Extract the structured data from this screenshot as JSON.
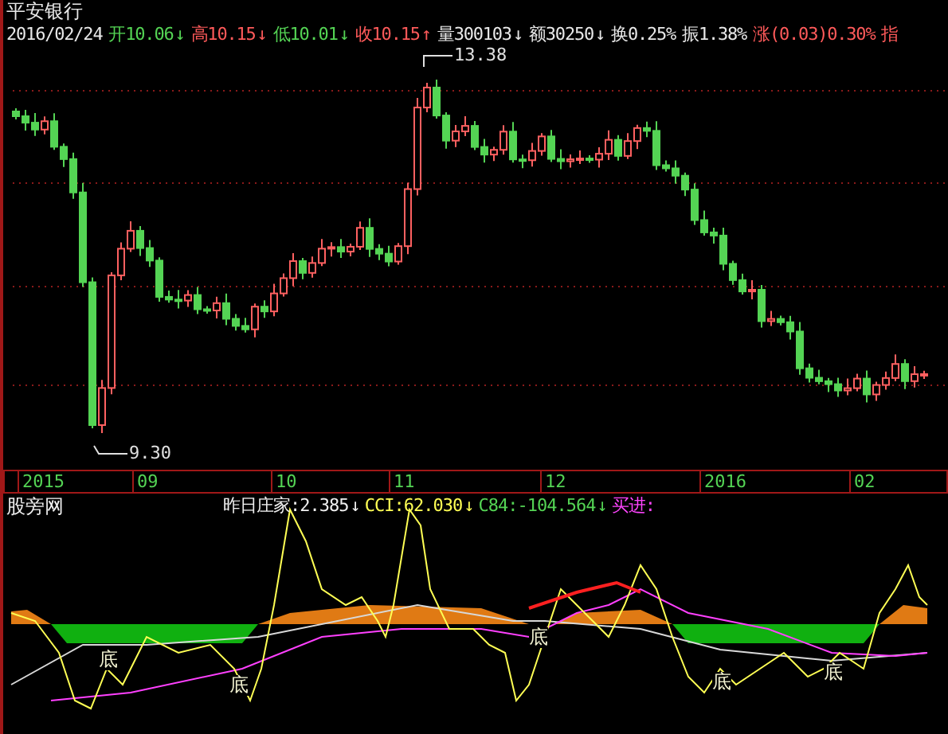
{
  "stock": {
    "name": "平安银行"
  },
  "quote": [
    {
      "text": "2016/02/24",
      "color": "#e8e8e8"
    },
    {
      "text": "开10.06",
      "arrow": "↓",
      "color": "#54d454"
    },
    {
      "text": "高10.15",
      "arrow": "↓",
      "color": "#ff5a5a"
    },
    {
      "text": "低10.01",
      "arrow": "↓",
      "color": "#54d454"
    },
    {
      "text": "收10.15",
      "arrow": "↑",
      "color": "#ff5a5a"
    },
    {
      "text": "量300103",
      "arrow": "↓",
      "color": "#e8e8e8"
    },
    {
      "text": "额30250",
      "arrow": "↓",
      "color": "#e8e8e8"
    },
    {
      "text": "换0.25%",
      "color": "#e8e8e8"
    },
    {
      "text": "振1.38%",
      "color": "#e8e8e8"
    },
    {
      "text": "涨(0.03)0.30%",
      "color": "#ff5a5a"
    },
    {
      "text": "指",
      "color": "#ff5a5a"
    }
  ],
  "price_chart": {
    "high_label": "13.38",
    "low_label": "9.30"
  },
  "time_axis": [
    "2015",
    "09",
    "10",
    "11",
    "12",
    "2016",
    "02"
  ],
  "indicator": {
    "name": "股旁网",
    "values": [
      {
        "text": "昨日庄家:2.385",
        "arrow": "↓",
        "color": "#f0f0f0"
      },
      {
        "text": "CCI:62.030",
        "arrow": "↓",
        "color": "#ffff54"
      },
      {
        "text": "C84:-104.564",
        "arrow": "↓",
        "color": "#54d454"
      },
      {
        "text": "买进:",
        "color": "#ff44ff"
      }
    ],
    "bottom_markers": [
      "底",
      "底",
      "底",
      "底",
      "底"
    ]
  }
}
